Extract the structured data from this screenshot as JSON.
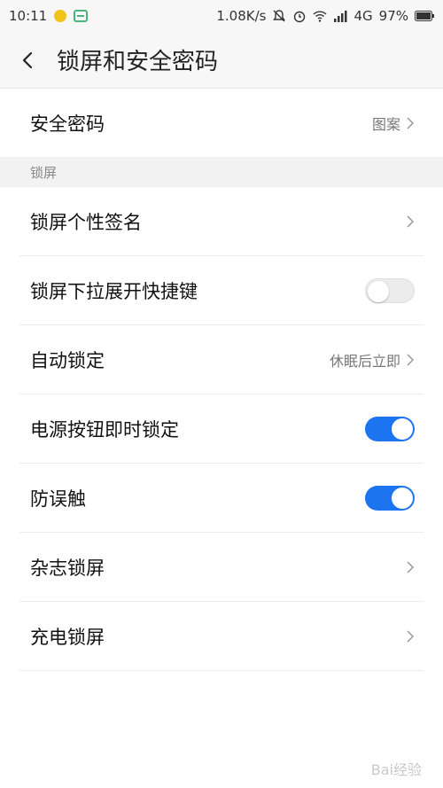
{
  "status_bar": {
    "time": "10:11",
    "net_speed": "1.08K/s",
    "network": "4G",
    "battery": "97%"
  },
  "header": {
    "title": "锁屏和安全密码"
  },
  "security_password": {
    "label": "安全密码",
    "value": "图案"
  },
  "section_lock": {
    "label": "锁屏"
  },
  "rows": {
    "signature": {
      "label": "锁屏个性签名"
    },
    "pulldown_shortcut": {
      "label": "锁屏下拉展开快捷键",
      "on": false
    },
    "auto_lock": {
      "label": "自动锁定",
      "value": "休眠后立即"
    },
    "power_lock": {
      "label": "电源按钮即时锁定",
      "on": true
    },
    "anti_touch": {
      "label": "防误触",
      "on": true
    },
    "magazine_lock": {
      "label": "杂志锁屏"
    },
    "charge_lock": {
      "label": "充电锁屏"
    }
  },
  "watermark": "Bai经验",
  "colors": {
    "accent": "#1d74f0",
    "toggle_off": "#ececec"
  }
}
